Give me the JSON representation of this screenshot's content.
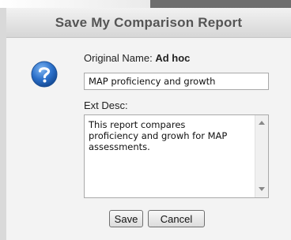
{
  "dialog": {
    "title": "Save My Comparison Report",
    "original_name_label": "Original Name:",
    "original_name_value": "Ad hoc",
    "name_input_value": "MAP proficiency and growth",
    "ext_desc_label": "Ext Desc:",
    "ext_desc_value": "This report compares\nproficiency and growh for MAP\nassessments.",
    "icon": "question-icon",
    "save_label": "Save",
    "cancel_label": "Cancel"
  },
  "colors": {
    "icon_blue": "#2a6fc9",
    "title_text": "#555555"
  }
}
